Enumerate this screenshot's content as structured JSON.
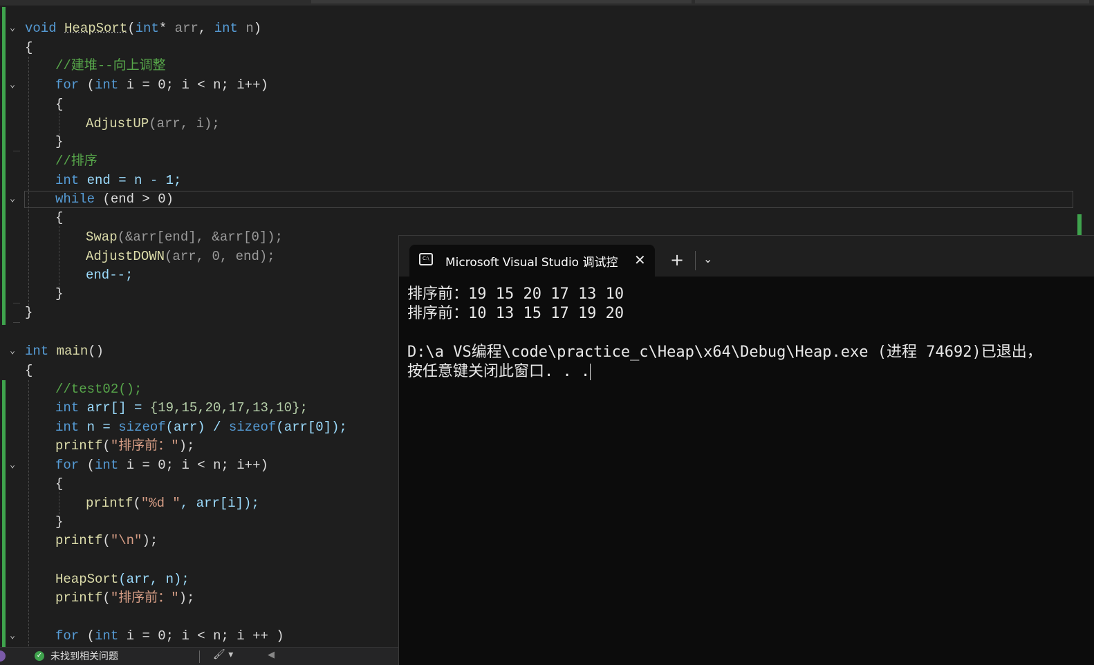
{
  "editor": {
    "heapsort": {
      "sig_void": "void",
      "sig_name": "HeapSort",
      "sig_open": "(",
      "sig_int1": "int",
      "sig_star": "*",
      "sig_arr": "arr",
      "sig_comma": ",",
      "sig_int2": "int",
      "sig_n": "n",
      "sig_close": ")",
      "brace_open": "{",
      "comment_build": "//建堆--向上调整",
      "for1": {
        "kw": "for",
        "open": "(",
        "int": "int",
        "body": "i = 0; i < n; i++)"
      },
      "brace2_open": "{",
      "adjust_up": {
        "fn": "AdjustUP",
        "args": "(arr, i);"
      },
      "brace2_close": "}",
      "comment_sort": "//排序",
      "end_decl": {
        "kw": "int",
        "rest": "end = n - 1;"
      },
      "while": {
        "kw": "while",
        "rest": "(end > 0)"
      },
      "brace3_open": "{",
      "swap": {
        "fn": "Swap",
        "args": "(&arr[end], &arr[0]);"
      },
      "adjust_down": {
        "fn": "AdjustDOWN",
        "args": "(arr, 0, end);"
      },
      "decrement": "end--;",
      "brace3_close": "}",
      "brace_close": "}"
    },
    "main": {
      "sig_int": "int",
      "sig_name": "main",
      "sig_parens": "()",
      "brace_open": "{",
      "comment_test": "//test02();",
      "arr_decl": {
        "kw": "int",
        "name": "arr[] = ",
        "values": "{19,15,20,17,13,10};"
      },
      "n_decl": {
        "kw": "int",
        "a": "n = ",
        "sizeof1": "sizeof",
        "b": "(arr) / ",
        "sizeof2": "sizeof",
        "c": "(arr[0]);"
      },
      "printf1": {
        "fn": "printf",
        "open": "(",
        "str": "\"排序前：\"",
        "close": ");"
      },
      "for1": {
        "kw": "for",
        "open": "(",
        "int": "int",
        "body": "i = 0; i < n; i++)"
      },
      "brace2_open": "{",
      "printf_loop": {
        "fn": "printf",
        "open": "(",
        "str": "\"%d \"",
        "close": ", arr[i]);"
      },
      "brace2_close": "}",
      "printf_nl": {
        "fn": "printf",
        "open": "(",
        "str": "\"\\n\"",
        "close": ");"
      },
      "heapsort_call": {
        "fn": "HeapSort",
        "args": "(arr, n);"
      },
      "printf2": {
        "fn": "printf",
        "open": "(",
        "str": "\"排序前：\"",
        "close": ");"
      },
      "for2": {
        "kw": "for",
        "open": "(",
        "int": "int",
        "body": "i = 0; i < n; i ++ )"
      }
    },
    "status": {
      "text": "未找到相关问题",
      "ok_icon": "check-icon",
      "brush_icon": "brush-icon"
    }
  },
  "terminal": {
    "tab_title": "Microsoft Visual Studio 调试控制台",
    "new_tab": "+",
    "dropdown": "⌄",
    "close": "✕",
    "lines": [
      "排序前：19 15 20 17 13 10",
      "排序前：10 13 15 17 19 20",
      "",
      "D:\\a VS编程\\code\\practice_c\\Heap\\x64\\Debug\\Heap.exe (进程 74692)已退出，",
      "按任意键关闭此窗口. . ."
    ]
  }
}
